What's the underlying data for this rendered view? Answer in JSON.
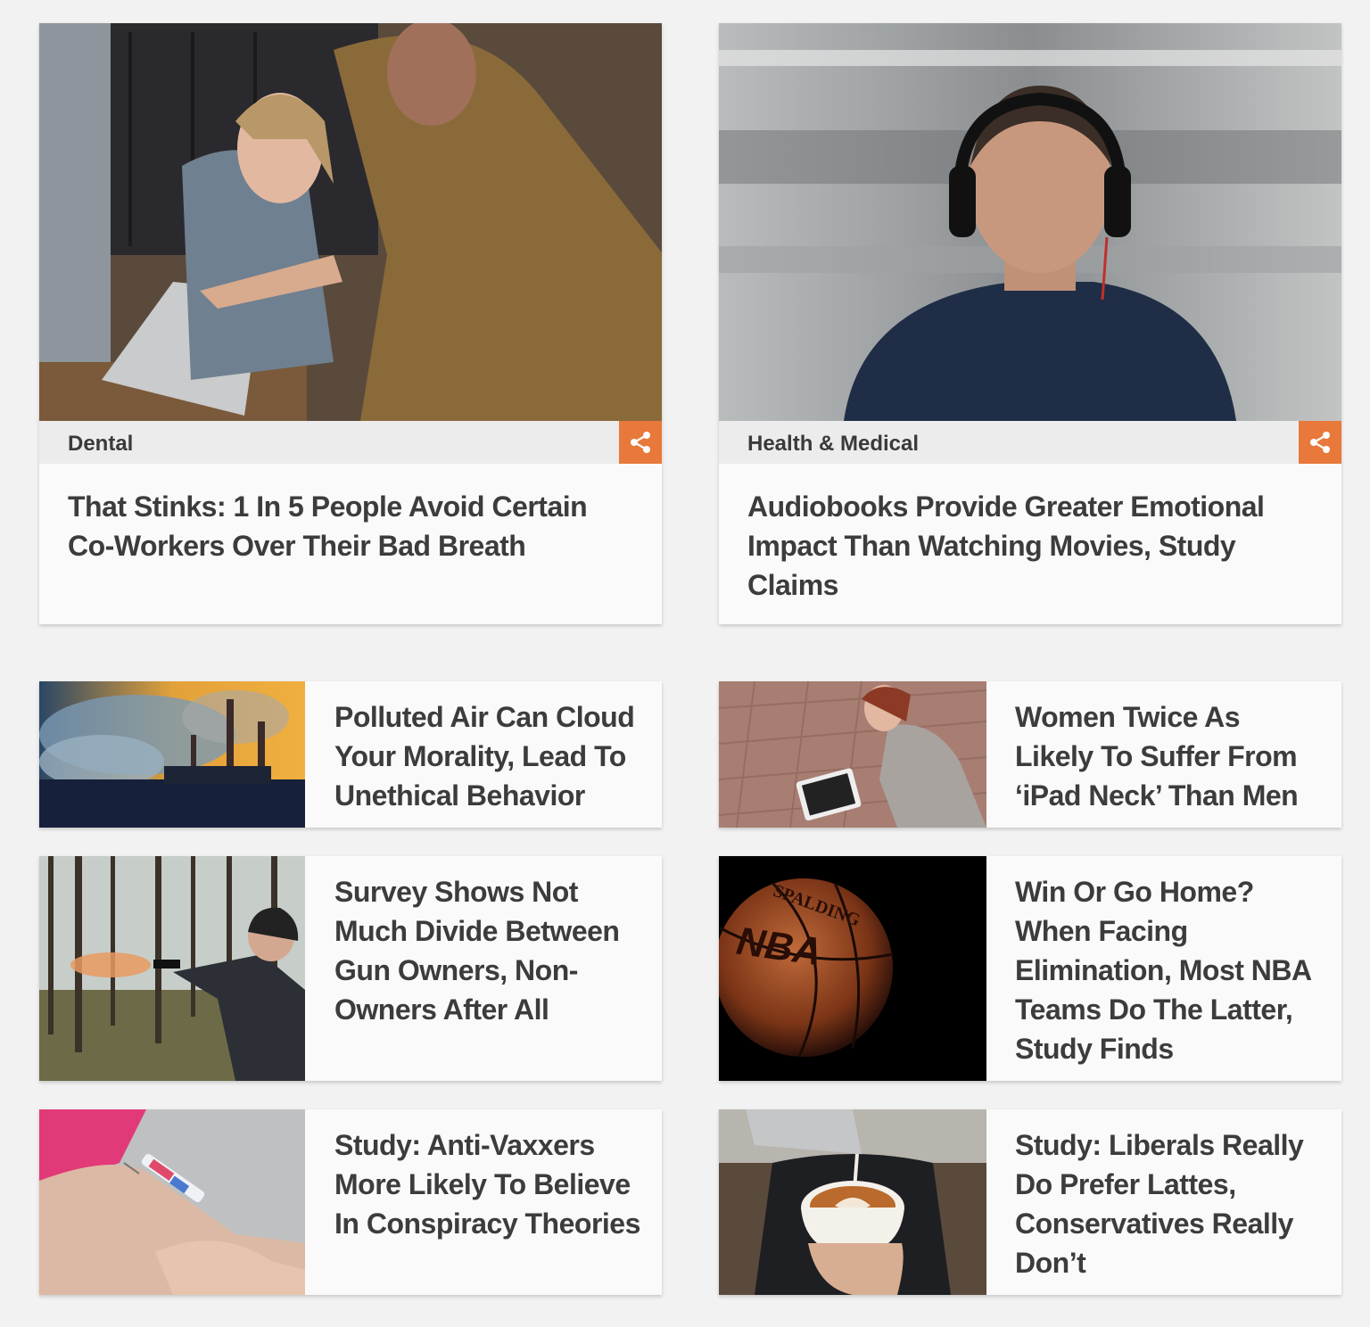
{
  "featured": [
    {
      "category": "Dental",
      "title": "That Stinks: 1 In 5 People Avoid Certain Co-Workers Over Their Bad Breath",
      "image": "office-coworkers-photo"
    },
    {
      "category": "Health & Medical",
      "title": "Audiobooks Provide Greater Emotional Impact Than Watching Movies, Study Claims",
      "image": "man-headphones-train-photo"
    }
  ],
  "list": [
    {
      "title": "Polluted Air Can Cloud Your Morality, Lead To Unethical Behavior",
      "image": "factory-smoke-photo"
    },
    {
      "title": "Women Twice As Likely To Suffer From ‘iPad Neck’ Than Men",
      "image": "woman-tablet-photo"
    },
    {
      "title": "Survey Shows Not Much Divide Between Gun Owners, Non-Owners After All",
      "image": "man-shooting-gun-photo"
    },
    {
      "title": "Win Or Go Home? When Facing Elimination, Most NBA Teams Do The Latter, Study Finds",
      "image": "basketball-photo",
      "ball_text": "NBA",
      "ball_brand": "SPALDING"
    },
    {
      "title": "Study: Anti-Vaxxers More Likely To Believe In Conspiracy Theories",
      "image": "vaccine-syringe-photo"
    },
    {
      "title": "Study: Liberals Really Do Prefer Lattes, Conservatives Really Don’t",
      "image": "latte-art-photo"
    }
  ],
  "colors": {
    "accent": "#e8793b",
    "background": "#f2f2f2",
    "card": "#fafafa",
    "text": "#3c3c3c"
  },
  "icons": {
    "share": "share-icon"
  }
}
